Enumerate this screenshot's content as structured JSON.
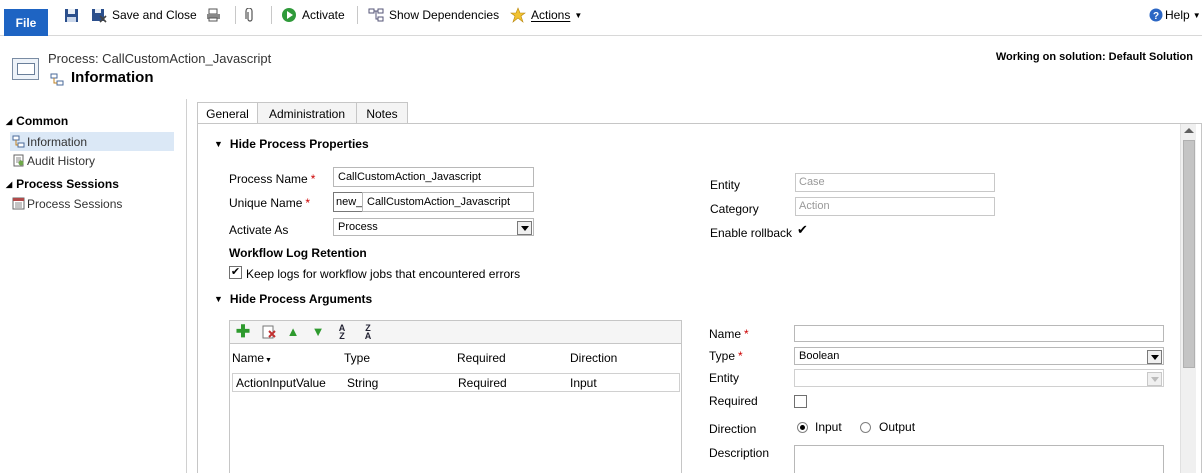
{
  "ribbon": {
    "file": "File",
    "save_and_close": "Save and Close",
    "activate": "Activate",
    "show_dependencies": "Show Dependencies",
    "actions": "Actions",
    "help": "Help"
  },
  "header": {
    "process_title": "Process: CallCustomAction_Javascript",
    "form_title": "Information",
    "solution": "Working on solution: Default Solution"
  },
  "leftnav": {
    "common": "Common",
    "items_common": [
      "Information",
      "Audit History"
    ],
    "process_sessions_header": "Process Sessions",
    "items_sessions": [
      "Process Sessions"
    ]
  },
  "tabs": [
    "General",
    "Administration",
    "Notes"
  ],
  "properties": {
    "section_title": "Hide Process Properties",
    "process_name_label": "Process Name",
    "process_name_value": "CallCustomAction_Javascript",
    "unique_name_label": "Unique Name",
    "unique_name_prefix": "new_",
    "unique_name_value": "CallCustomAction_Javascript",
    "activate_as_label": "Activate As",
    "activate_as_value": "Process",
    "log_retention_label": "Workflow Log Retention",
    "keep_logs_label": "Keep logs for workflow jobs that encountered errors",
    "keep_logs_checked": true,
    "entity_label": "Entity",
    "entity_value": "Case",
    "category_label": "Category",
    "category_value": "Action",
    "enable_rollback_label": "Enable rollback",
    "enable_rollback_checked": true
  },
  "arguments": {
    "section_title": "Hide Process Arguments",
    "columns": [
      "Name",
      "Type",
      "Required",
      "Direction"
    ],
    "rows": [
      {
        "name": "ActionInputValue",
        "type": "String",
        "required": "Required",
        "direction": "Input"
      }
    ],
    "name_label": "Name",
    "type_label": "Type",
    "type_value": "Boolean",
    "entity_label": "Entity",
    "required_label": "Required",
    "direction_label": "Direction",
    "direction_input": "Input",
    "direction_output": "Output",
    "direction_selected": "Input",
    "description_label": "Description"
  }
}
